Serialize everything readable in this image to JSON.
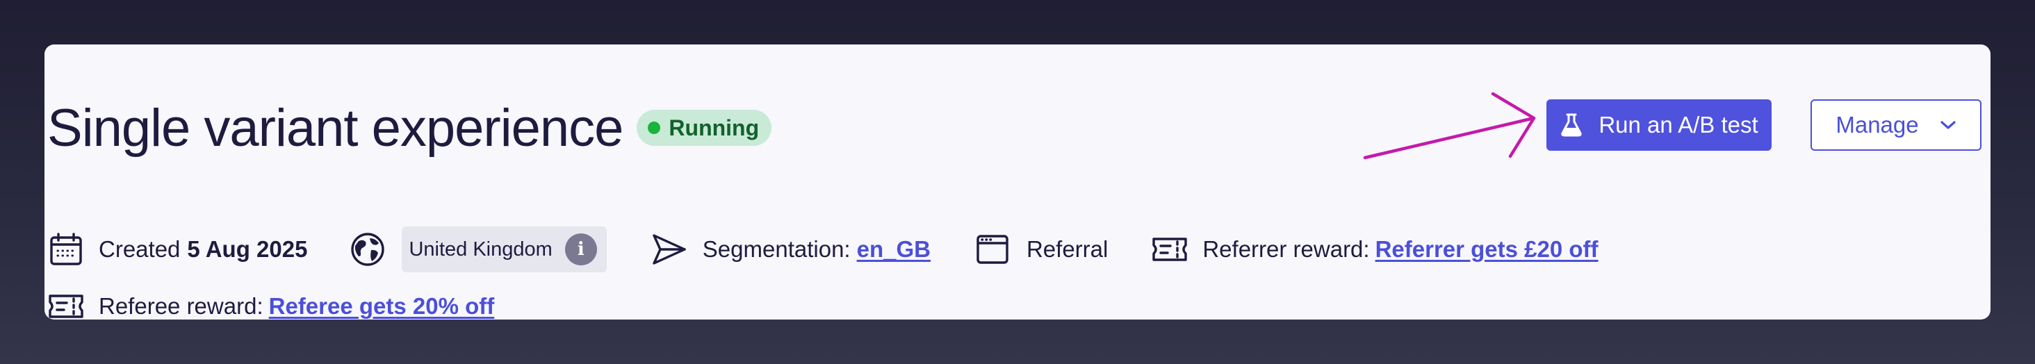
{
  "header": {
    "title": "Single variant experience",
    "status": "Running"
  },
  "actions": {
    "ab_test_label": "Run an A/B test",
    "manage_label": "Manage"
  },
  "meta": {
    "created_label": "Created",
    "created_date": "5 Aug 2025",
    "country": "United Kingdom",
    "info_glyph": "i",
    "segmentation_label": "Segmentation:",
    "segmentation_value": "en_GB",
    "program_type": "Referral",
    "referrer_reward_label": "Referrer reward:",
    "referrer_reward_value": "Referrer gets £20 off",
    "referee_reward_label": "Referee reward:",
    "referee_reward_value": "Referee gets 20% off"
  },
  "icons": {
    "created": "calendar-icon",
    "country": "globe-icon",
    "segmentation": "send-icon",
    "program_type": "browser-window-icon",
    "reward": "ticket-icon",
    "ab_test": "flask-icon",
    "manage": "chevron-down-icon"
  },
  "colors": {
    "accent": "#4f52dd",
    "link": "#4b4fd9",
    "status_bg": "#c9ead6",
    "status_dot": "#18b53a",
    "status_text": "#12612c",
    "annotation_arrow": "#c41aa8",
    "title_text": "#1e1b3f"
  }
}
